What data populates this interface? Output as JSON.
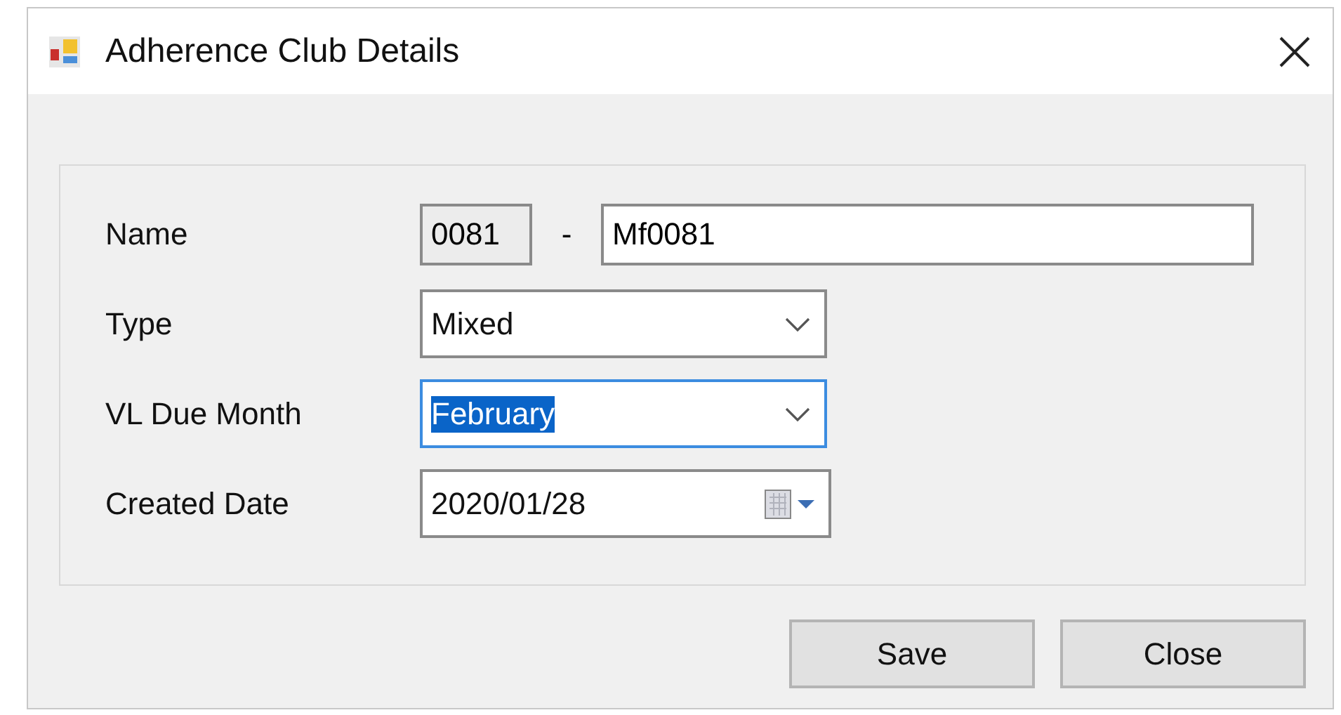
{
  "window": {
    "title": "Adherence Club Details"
  },
  "fields": [
    {
      "kind": "name",
      "label": "Name",
      "code": "0081",
      "separator": "-",
      "value": "Mf0081"
    },
    {
      "kind": "combo",
      "label": "Type",
      "value": "Mixed",
      "focused": false
    },
    {
      "kind": "combo",
      "label": "VL Due Month",
      "value": "February",
      "focused": true
    },
    {
      "kind": "date",
      "label": "Created Date",
      "value": "2020/01/28"
    }
  ],
  "buttons": [
    "Save",
    "Close"
  ]
}
